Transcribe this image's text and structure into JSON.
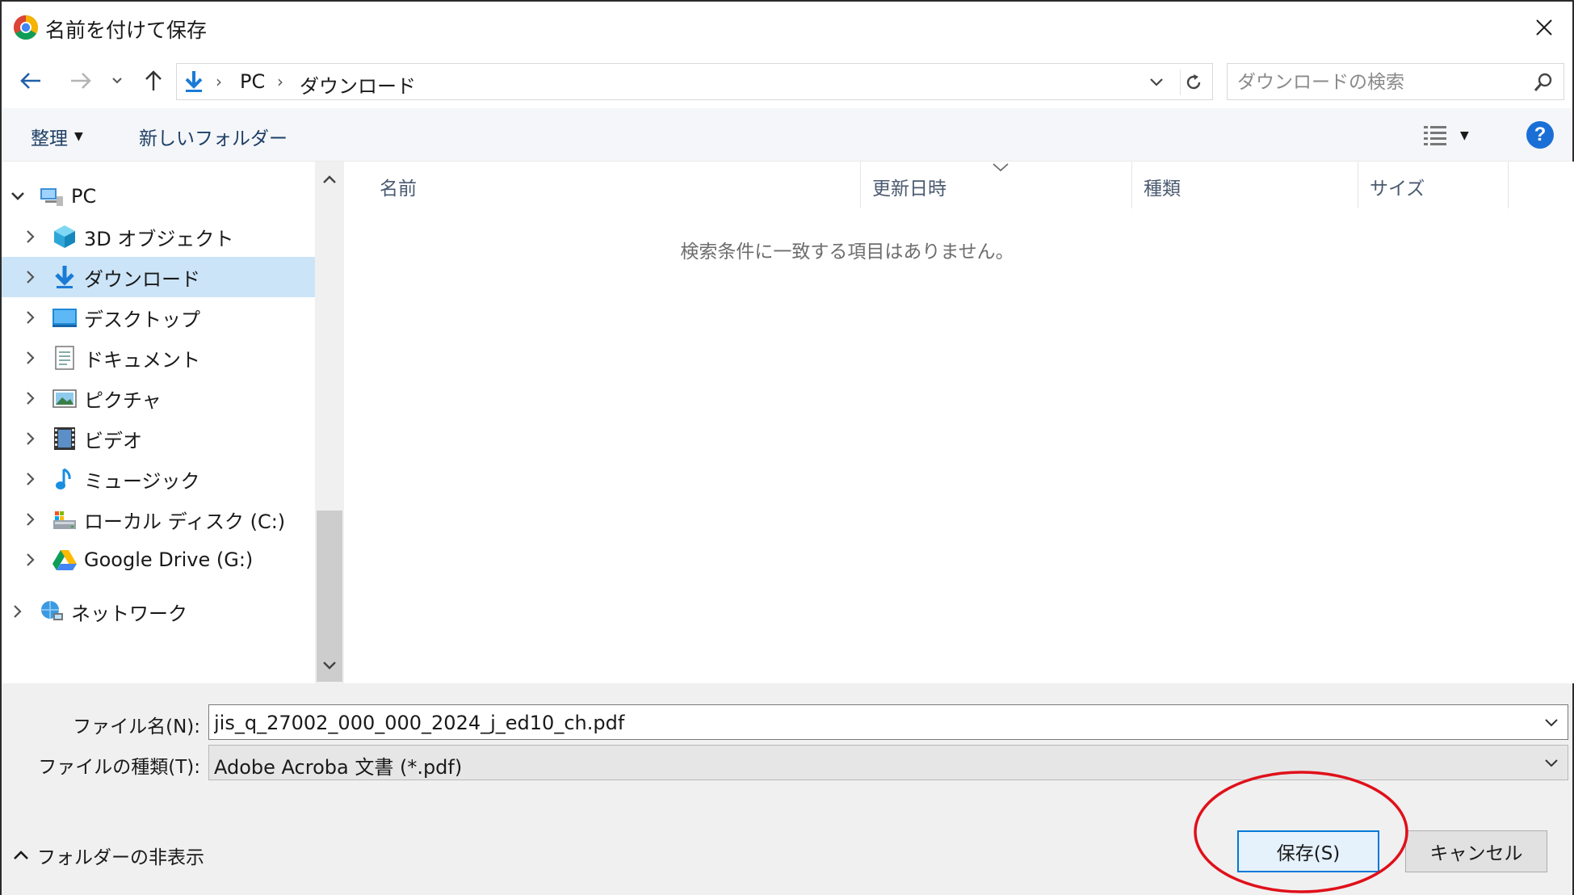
{
  "window": {
    "title": "名前を付けて保存"
  },
  "address_bar": {
    "crumbs": [
      "PC",
      "ダウンロード"
    ],
    "search_placeholder": "ダウンロードの検索"
  },
  "toolbar": {
    "organize_label": "整理",
    "new_folder_label": "新しいフォルダー"
  },
  "nav_tree": {
    "items": [
      {
        "label": "PC",
        "icon": "pc-icon",
        "expanded": true
      },
      {
        "label": "3D オブジェクト",
        "icon": "3d-objects-icon"
      },
      {
        "label": "ダウンロード",
        "icon": "download-icon",
        "selected": true
      },
      {
        "label": "デスクトップ",
        "icon": "desktop-icon"
      },
      {
        "label": "ドキュメント",
        "icon": "documents-icon"
      },
      {
        "label": "ピクチャ",
        "icon": "pictures-icon"
      },
      {
        "label": "ビデオ",
        "icon": "videos-icon"
      },
      {
        "label": "ミュージック",
        "icon": "music-icon"
      },
      {
        "label": "ローカル ディスク (C:)",
        "icon": "local-disk-icon"
      },
      {
        "label": "Google Drive (G:)",
        "icon": "google-drive-icon"
      },
      {
        "label": "ネットワーク",
        "icon": "network-icon"
      }
    ]
  },
  "file_list": {
    "columns": [
      "名前",
      "更新日時",
      "種類",
      "サイズ"
    ],
    "empty_message": "検索条件に一致する項目はありません。"
  },
  "form": {
    "filename_label": "ファイル名(N):",
    "filename_value": "jis_q_27002_000_000_2024_j_ed10_ch.pdf",
    "filetype_label": "ファイルの種類(T):",
    "filetype_value": "Adobe Acroba 文書 (*.pdf)"
  },
  "footer": {
    "hide_folders_label": "フォルダーの非表示",
    "save_label": "保存(S)",
    "cancel_label": "キャンセル"
  },
  "colors": {
    "accent": "#0078d7",
    "selection": "#cce4f7",
    "annotation": "#e0101a"
  }
}
